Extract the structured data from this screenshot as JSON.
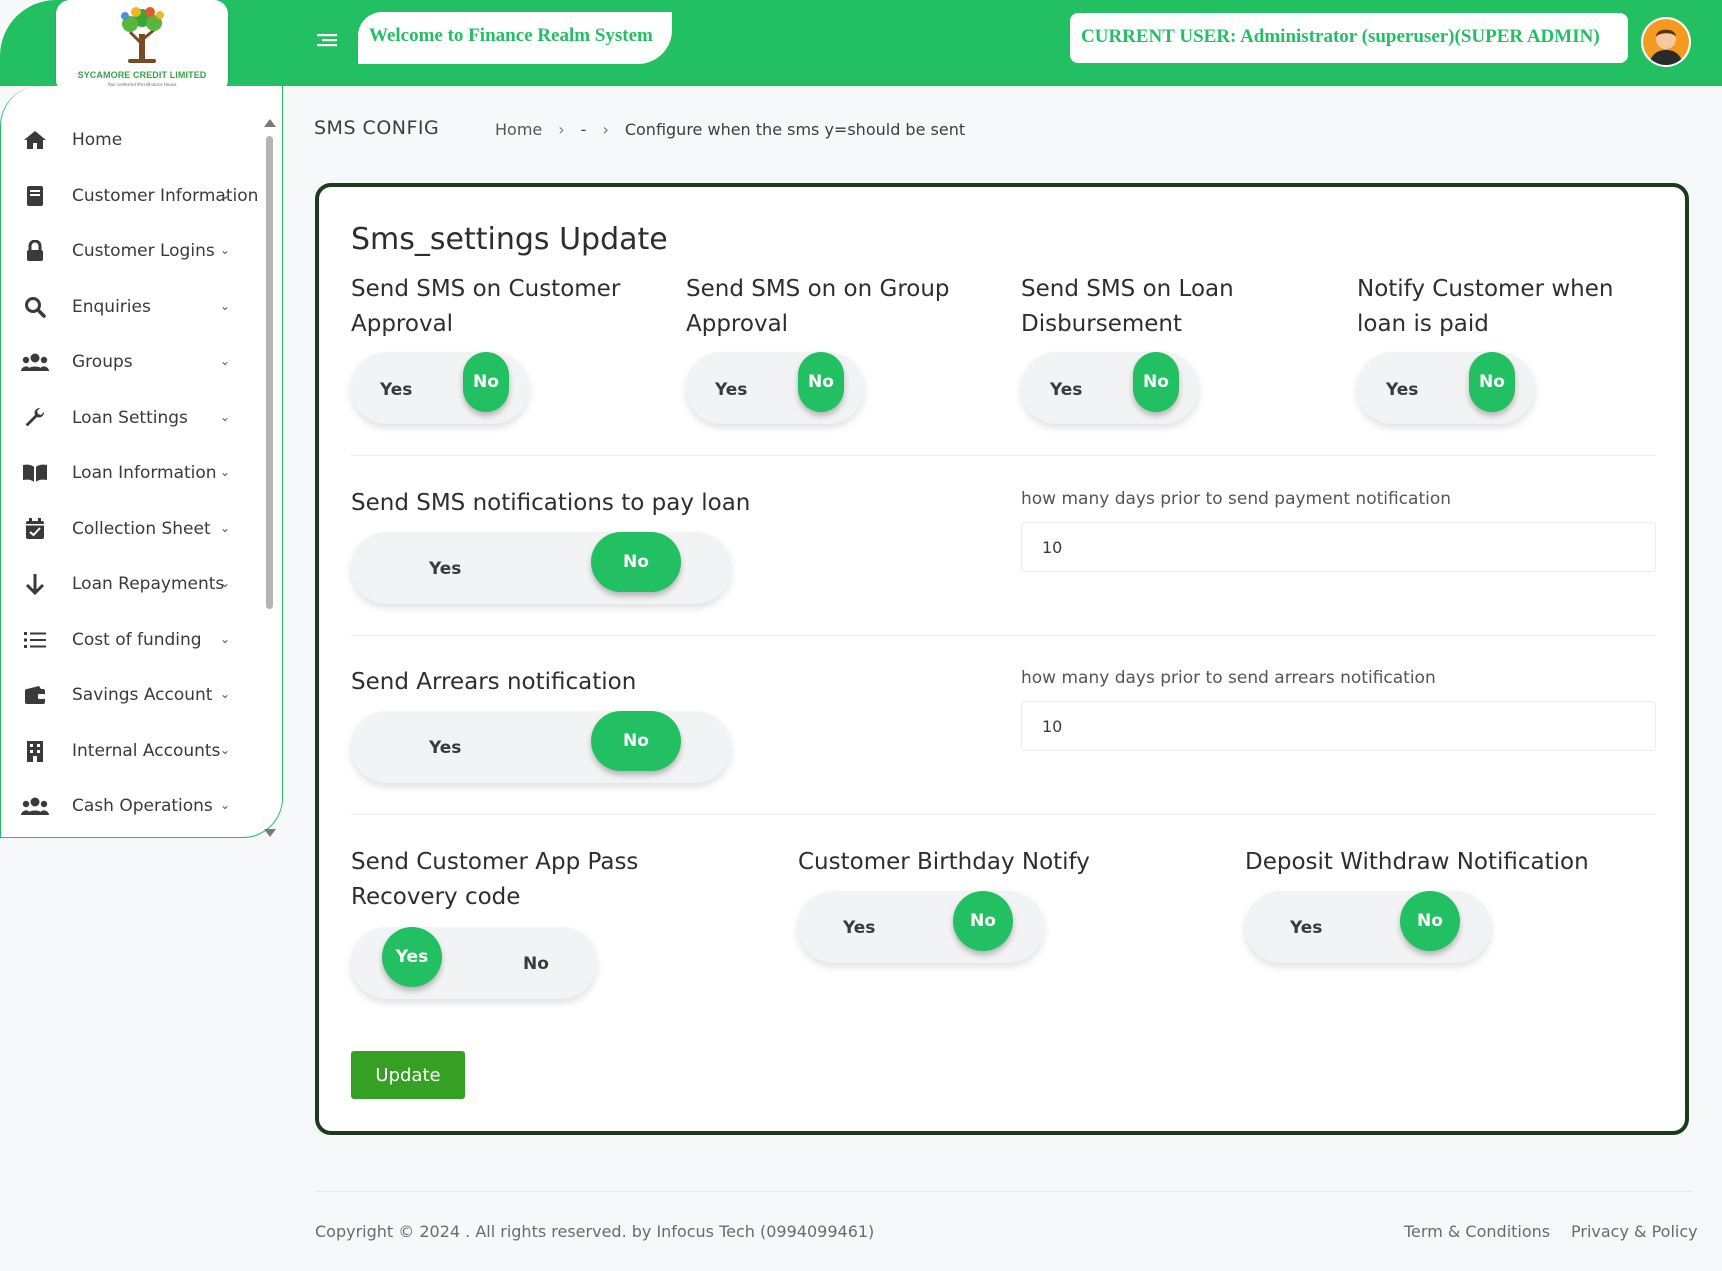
{
  "header": {
    "company_name": "SYCAMORE CREDIT LIMITED",
    "company_tagline": "Your preferred Microfinance House",
    "welcome": "Welcome to Finance Realm System",
    "current_user": "CURRENT USER: Administrator (superuser)(SUPER ADMIN)",
    "brand_color": "#23bf63"
  },
  "sidebar": {
    "items": [
      {
        "label": "Home",
        "icon": "home-icon"
      },
      {
        "label": "Customer Information",
        "icon": "book-icon"
      },
      {
        "label": "Customer Logins",
        "icon": "lock-icon"
      },
      {
        "label": "Enquiries",
        "icon": "search-icon"
      },
      {
        "label": "Groups",
        "icon": "users-icon"
      },
      {
        "label": "Loan Settings",
        "icon": "wrench-icon"
      },
      {
        "label": "Loan Information",
        "icon": "open-book-icon"
      },
      {
        "label": "Collection Sheet",
        "icon": "calendar-check-icon"
      },
      {
        "label": "Loan Repayments",
        "icon": "arrow-down-icon"
      },
      {
        "label": "Cost of funding",
        "icon": "list-icon"
      },
      {
        "label": "Savings Account",
        "icon": "wallet-icon"
      },
      {
        "label": "Internal Accounts",
        "icon": "building-icon"
      },
      {
        "label": "Cash Operations",
        "icon": "users-icon"
      }
    ]
  },
  "page": {
    "title": "SMS CONFIG",
    "breadcrumb": {
      "home": "Home",
      "sep1": "›",
      "middle": "-",
      "sep2": "›",
      "current": "Configure when the sms y=should be sent"
    }
  },
  "form": {
    "title": "Sms_settings Update",
    "yes_label": "Yes",
    "no_label": "No",
    "row1": [
      {
        "label_line1": "Send SMS on Customer",
        "label_line2": "Approval",
        "value": "No"
      },
      {
        "label_line1": "Send SMS on on Group",
        "label_line2": "Approval",
        "value": "No"
      },
      {
        "label_line1": "Send SMS on Loan",
        "label_line2": "Disbursement",
        "value": "No"
      },
      {
        "label_line1": "Notify Customer when",
        "label_line2": "loan is paid",
        "value": "No"
      }
    ],
    "pay_loan": {
      "label": "Send SMS notifications to pay loan",
      "value": "No",
      "days_label": "how many days prior to send payment notification",
      "days_value": "10"
    },
    "arrears": {
      "label": "Send Arrears notification",
      "value": "No",
      "days_label": "how many days prior to send arrears notification",
      "days_value": "10"
    },
    "row4": [
      {
        "label_line1": "Send Customer App Pass",
        "label_line2": "Recovery code",
        "value": "Yes"
      },
      {
        "label_line1": "Customer Birthday Notify",
        "label_line2": "",
        "value": "No"
      },
      {
        "label_line1": "Deposit Withdraw Notification",
        "label_line2": "",
        "value": "No"
      }
    ],
    "update_label": "Update"
  },
  "footer": {
    "copyright": "Copyright © 2024 . All rights reserved. by Infocus Tech (0994099461)",
    "terms": "Term & Conditions",
    "privacy": "Privacy & Policy"
  }
}
